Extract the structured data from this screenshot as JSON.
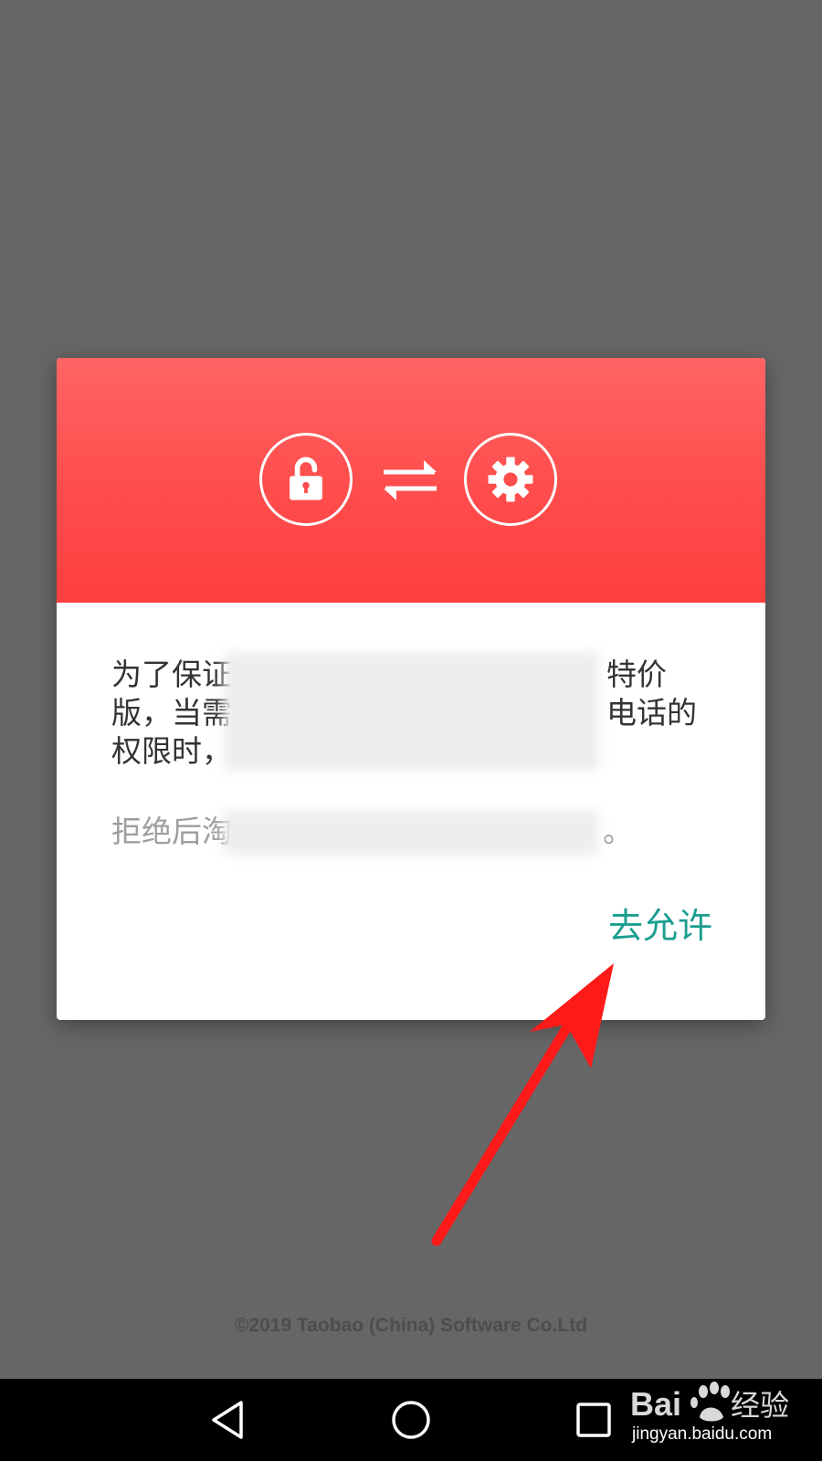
{
  "dialog": {
    "message_visible_start_1": "为了保证",
    "message_visible_end_1": "特价",
    "message_visible_start_2": "版，当需",
    "message_visible_end_2": "电话的",
    "message_visible_start_3": "权限时，",
    "note_visible_start": "拒绝后淘",
    "note_visible_end": "。",
    "allow_button_label": "去允许",
    "header_color": "#ff4c4c",
    "icons": [
      "unlock-icon",
      "swap-arrows-icon",
      "gear-icon"
    ]
  },
  "footer": {
    "copyright": "©2019 Taobao (China) Software Co.Ltd"
  },
  "annotation": {
    "arrow_color": "#ff1a1a"
  },
  "nav_bar": {
    "buttons": [
      "back-icon",
      "home-icon",
      "recent-apps-icon"
    ]
  },
  "watermark": {
    "logo_text": "Bai经验",
    "url": "jingyan.baidu.com"
  }
}
